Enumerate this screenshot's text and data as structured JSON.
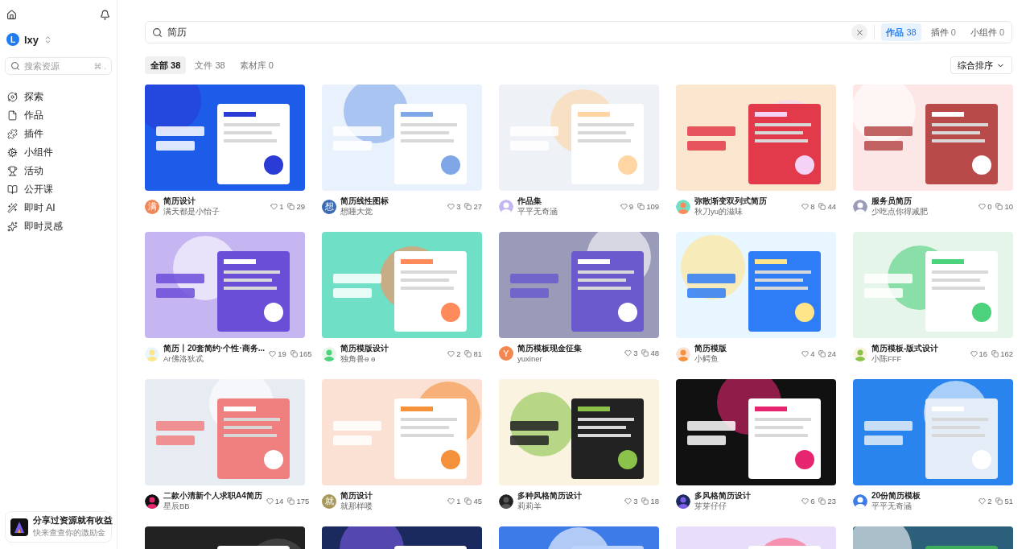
{
  "sidebar": {
    "user": {
      "initial": "L",
      "name": "lxy"
    },
    "search": {
      "placeholder": "搜索资源",
      "shortcut": "⌘ ."
    },
    "items": [
      {
        "label": "探索"
      },
      {
        "label": "作品"
      },
      {
        "label": "插件"
      },
      {
        "label": "小组件"
      },
      {
        "label": "活动"
      },
      {
        "label": "公开课"
      },
      {
        "label": "即时 AI"
      },
      {
        "label": "即时灵感"
      }
    ],
    "promo": {
      "title": "分享过资源就有收益",
      "subtitle": "快来查查你的激励金"
    }
  },
  "search": {
    "value": "简历",
    "scopes": [
      {
        "label": "作品",
        "count": "38",
        "selected": true
      },
      {
        "label": "插件",
        "count": "0",
        "selected": false
      },
      {
        "label": "小组件",
        "count": "0",
        "selected": false
      }
    ]
  },
  "filters": [
    {
      "label": "全部",
      "count": "38",
      "selected": true
    },
    {
      "label": "文件",
      "count": "38",
      "selected": false
    },
    {
      "label": "素材库",
      "count": "0",
      "selected": false
    }
  ],
  "sort": "综合排序",
  "cards": [
    {
      "thumbnail": {
        "kind": "picture"
      },
      "title": "简历设计",
      "author": "满天都是小怡子",
      "likes": "1",
      "copies": "29",
      "avatar": {
        "kind": "letter",
        "text": "满",
        "color": "#f0875a"
      }
    },
    {
      "thumbnail": {
        "kind": "picture"
      },
      "title": "简历线性图标",
      "author": "想睡大觉",
      "likes": "3",
      "copies": "27",
      "avatar": {
        "kind": "letter",
        "text": "想",
        "color": "#3c6bb4"
      }
    },
    {
      "thumbnail": {
        "kind": "picture"
      },
      "title": "作品集",
      "author": "平平无奇涵",
      "likes": "9",
      "copies": "109",
      "avatar": {
        "kind": "picture"
      }
    },
    {
      "thumbnail": {
        "kind": "picture"
      },
      "title": "弥散渐变双列式简历",
      "author": "秋刀yu的滋味",
      "likes": "8",
      "copies": "44",
      "avatar": {
        "kind": "picture"
      }
    },
    {
      "thumbnail": {
        "kind": "picture"
      },
      "title": "服务员简历",
      "author": "少吃点你得减肥",
      "likes": "0",
      "copies": "10",
      "avatar": {
        "kind": "picture"
      }
    },
    {
      "thumbnail": {
        "kind": "picture"
      },
      "title": "简历丨20套简约·个性·商务...",
      "author": "Ar佛洛狄忒",
      "likes": "19",
      "copies": "165",
      "avatar": {
        "kind": "picture"
      }
    },
    {
      "thumbnail": {
        "kind": "picture"
      },
      "title": "简历模版设计",
      "author": "独角兽ɵ ɵ",
      "likes": "2",
      "copies": "81",
      "avatar": {
        "kind": "picture"
      }
    },
    {
      "thumbnail": {
        "kind": "picture"
      },
      "title": "简历模板现金征集",
      "author": "yuxiner",
      "likes": "3",
      "copies": "48",
      "avatar": {
        "kind": "letter",
        "text": "Y",
        "color": "#f2874f"
      }
    },
    {
      "thumbnail": {
        "kind": "picture"
      },
      "title": "简历模版",
      "author": "小鳄鱼",
      "likes": "4",
      "copies": "24",
      "avatar": {
        "kind": "picture"
      }
    },
    {
      "thumbnail": {
        "kind": "picture"
      },
      "title": "简历模板-版式设计",
      "author": "小陈FFF",
      "likes": "16",
      "copies": "162",
      "avatar": {
        "kind": "picture"
      }
    },
    {
      "thumbnail": {
        "kind": "picture"
      },
      "title": "二款小清新个人求职A4简历",
      "author": "星辰BB",
      "likes": "14",
      "copies": "175",
      "avatar": {
        "kind": "picture"
      }
    },
    {
      "thumbnail": {
        "kind": "picture"
      },
      "title": "简历设计",
      "author": "就那样喽",
      "likes": "1",
      "copies": "45",
      "avatar": {
        "kind": "letter",
        "text": "就",
        "color": "#a8995a"
      }
    },
    {
      "thumbnail": {
        "kind": "picture"
      },
      "title": "多种风格简历设计",
      "author": "莉莉羊",
      "likes": "3",
      "copies": "18",
      "avatar": {
        "kind": "picture"
      }
    },
    {
      "thumbnail": {
        "kind": "picture"
      },
      "title": "多风格简历设计",
      "author": "芽芽仔仔",
      "likes": "6",
      "copies": "23",
      "avatar": {
        "kind": "picture"
      }
    },
    {
      "thumbnail": {
        "kind": "picture"
      },
      "title": "20份简历模板",
      "author": "平平无奇涵",
      "likes": "2",
      "copies": "51",
      "avatar": {
        "kind": "picture"
      }
    },
    {
      "thumbnail": {
        "kind": "picture"
      }
    },
    {
      "thumbnail": {
        "kind": "picture"
      }
    },
    {
      "thumbnail": {
        "kind": "picture"
      }
    },
    {
      "thumbnail": {
        "kind": "picture"
      }
    },
    {
      "thumbnail": {
        "kind": "picture"
      }
    }
  ]
}
